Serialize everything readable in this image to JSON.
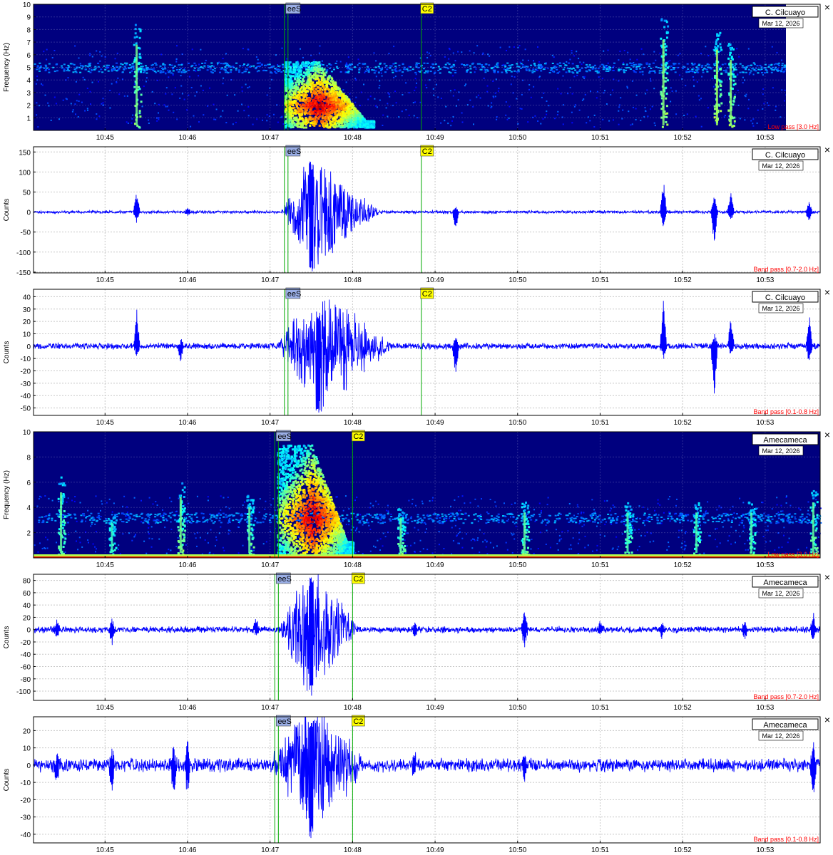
{
  "figure": {
    "time_ticks": [
      "10:45",
      "10:46",
      "10:47",
      "10:48",
      "10:49",
      "10:50",
      "10:51",
      "10:52",
      "10:53"
    ],
    "close_glyph": "×",
    "colors": {
      "trace": "#0000ff",
      "spectrogram_bg": "#00007f",
      "filter_label": "#ff0000",
      "pick_line": "#00aa00",
      "phase_marker_ees": "#9aaee6",
      "phase_marker_c2": "#ffff00",
      "grid": "#c8c8c8"
    }
  },
  "chart_data": [
    {
      "id": "p1",
      "type": "heatmap",
      "kind": "spectrogram",
      "station": "C. Cilcuayo",
      "date": "Mar 12, 2026",
      "filter": "Low pass [3.0 Hz]",
      "ylabel": "Frequency (Hz)",
      "ylim": [
        0,
        10
      ],
      "yticks": [
        "1",
        "2",
        "3",
        "4",
        "5",
        "6",
        "7",
        "8",
        "9",
        "10"
      ],
      "ytick_values": [
        1,
        2,
        3,
        4,
        5,
        6,
        7,
        8,
        9,
        10
      ],
      "xlim": [
        "10:44:08",
        "10:53:40"
      ],
      "picks": [
        {
          "label": "eeS",
          "time": "10:47:12"
        },
        {
          "label": "C2",
          "time": "10:48:50"
        }
      ],
      "events": [
        {
          "time": "10:45:23",
          "fmax": 8.5,
          "strength": 0.7
        },
        {
          "time": "10:51:46",
          "fmax": 9.0,
          "strength": 0.8
        },
        {
          "time": "10:52:25",
          "fmax": 8.0,
          "strength": 0.9
        },
        {
          "time": "10:52:35",
          "fmax": 7.0,
          "strength": 0.8
        }
      ],
      "noise_band_hz": 5.0,
      "main_event": {
        "start": "10:47:10",
        "end": "10:48:15",
        "peak_time": "10:47:35",
        "fmax": 5.5,
        "peak_freq": 2.0
      }
    },
    {
      "id": "p2",
      "type": "line",
      "kind": "waveform",
      "station": "C. Cilcuayo",
      "date": "Mar 12, 2026",
      "filter": "Band pass [0.7-2.0 Hz]",
      "ylabel": "Counts",
      "ylim": [
        -152,
        163
      ],
      "yticks": [
        "150",
        "100",
        "50",
        "0",
        "-50",
        "-100",
        "-150"
      ],
      "ytick_values": [
        150,
        100,
        50,
        0,
        -50,
        -100,
        -150
      ],
      "xlim": [
        "10:44:08",
        "10:53:40"
      ],
      "picks": [
        {
          "label": "eeS",
          "time": "10:47:12"
        },
        {
          "label": "C2",
          "time": "10:48:50"
        }
      ],
      "noise_level": 3,
      "main_event": {
        "start": "10:47:08",
        "peak_time": "10:47:30",
        "end": "10:48:20",
        "max": 130,
        "min": -150
      },
      "spikes": [
        {
          "time": "10:45:23",
          "max": 55,
          "min": -30
        },
        {
          "time": "10:46:00",
          "max": 10,
          "min": -10
        },
        {
          "time": "10:49:15",
          "max": 15,
          "min": -55
        },
        {
          "time": "10:51:46",
          "max": 85,
          "min": -45
        },
        {
          "time": "10:52:23",
          "max": 45,
          "min": -90
        },
        {
          "time": "10:52:35",
          "max": 55,
          "min": -25
        },
        {
          "time": "10:53:32",
          "max": 25,
          "min": -25
        }
      ]
    },
    {
      "id": "p3",
      "type": "line",
      "kind": "waveform",
      "station": "C. Cilcuayo",
      "date": "Mar 12, 2026",
      "filter": "Band pass [0.1-0.8 Hz]",
      "ylabel": "Counts",
      "ylim": [
        -56,
        46
      ],
      "yticks": [
        "40",
        "30",
        "20",
        "10",
        "0",
        "-10",
        "-20",
        "-30",
        "-40",
        "-50"
      ],
      "ytick_values": [
        40,
        30,
        20,
        10,
        0,
        -10,
        -20,
        -30,
        -40,
        -50
      ],
      "xlim": [
        "10:44:08",
        "10:53:40"
      ],
      "picks": [
        {
          "label": "eeS",
          "time": "10:47:12"
        },
        {
          "label": "C2",
          "time": "10:48:50"
        }
      ],
      "noise_level": 2,
      "main_event": {
        "start": "10:47:05",
        "peak_time": "10:47:35",
        "end": "10:48:30",
        "max": 28,
        "min": -55
      },
      "spikes": [
        {
          "time": "10:45:23",
          "max": 32,
          "min": -10
        },
        {
          "time": "10:45:55",
          "max": 5,
          "min": -13
        },
        {
          "time": "10:49:15",
          "max": 8,
          "min": -27
        },
        {
          "time": "10:51:46",
          "max": 40,
          "min": -12
        },
        {
          "time": "10:52:23",
          "max": 12,
          "min": -47
        },
        {
          "time": "10:52:35",
          "max": 25,
          "min": -8
        },
        {
          "time": "10:53:32",
          "max": 28,
          "min": -14
        }
      ]
    },
    {
      "id": "p4",
      "type": "heatmap",
      "kind": "spectrogram",
      "station": "Amecameca",
      "date": "Mar 12, 2026",
      "filter": "Low pass [3.0 Hz]",
      "ylabel": "Frequency (Hz)",
      "ylim": [
        0,
        10
      ],
      "yticks": [
        "2",
        "4",
        "6",
        "8",
        "10"
      ],
      "ytick_values": [
        2,
        4,
        6,
        8,
        10
      ],
      "xlim": [
        "10:44:08",
        "10:53:40"
      ],
      "picks": [
        {
          "label": "eeS",
          "time": "10:47:05"
        },
        {
          "label": "C2",
          "time": "10:48:00"
        }
      ],
      "events": [
        {
          "time": "10:44:28",
          "fmax": 6.5,
          "strength": 0.6
        },
        {
          "time": "10:45:05",
          "fmax": 3.5,
          "strength": 0.4
        },
        {
          "time": "10:45:55",
          "fmax": 6.0,
          "strength": 0.7
        },
        {
          "time": "10:46:45",
          "fmax": 5.0,
          "strength": 0.6
        },
        {
          "time": "10:48:35",
          "fmax": 4.0,
          "strength": 0.6
        },
        {
          "time": "10:50:05",
          "fmax": 4.5,
          "strength": 0.6
        },
        {
          "time": "10:51:20",
          "fmax": 4.5,
          "strength": 0.5
        },
        {
          "time": "10:52:10",
          "fmax": 4.5,
          "strength": 0.5
        },
        {
          "time": "10:52:50",
          "fmax": 4.5,
          "strength": 0.5
        },
        {
          "time": "10:53:35",
          "fmax": 5.5,
          "strength": 0.6
        }
      ],
      "noise_band_hz": 3.2,
      "low_band": true,
      "main_event": {
        "start": "10:47:05",
        "end": "10:48:00",
        "peak_time": "10:47:30",
        "fmax": 9.0,
        "peak_freq": 3.2
      }
    },
    {
      "id": "p5",
      "type": "line",
      "kind": "waveform",
      "station": "Amecameca",
      "date": "Mar 12, 2026",
      "filter": "Band pass [0.7-2.0 Hz]",
      "ylabel": "Counts",
      "ylim": [
        -115,
        90
      ],
      "yticks": [
        "80",
        "60",
        "40",
        "20",
        "0",
        "-20",
        "-40",
        "-60",
        "-80",
        "-100"
      ],
      "ytick_values": [
        80,
        60,
        40,
        20,
        0,
        -20,
        -40,
        -60,
        -80,
        -100
      ],
      "xlim": [
        "10:44:08",
        "10:53:40"
      ],
      "picks": [
        {
          "label": "eeS",
          "time": "10:47:05"
        },
        {
          "label": "C2",
          "time": "10:48:00"
        }
      ],
      "noise_level": 4,
      "main_event": {
        "start": "10:47:05",
        "peak_time": "10:47:30",
        "end": "10:48:05",
        "max": 85,
        "min": -112
      },
      "spikes": [
        {
          "time": "10:44:25",
          "max": 15,
          "min": -15
        },
        {
          "time": "10:45:05",
          "max": 18,
          "min": -28
        },
        {
          "time": "10:46:50",
          "max": 20,
          "min": -10
        },
        {
          "time": "10:48:45",
          "max": 15,
          "min": -15
        },
        {
          "time": "10:50:05",
          "max": 35,
          "min": -35
        },
        {
          "time": "10:51:00",
          "max": 15,
          "min": -12
        },
        {
          "time": "10:51:45",
          "max": 14,
          "min": -14
        },
        {
          "time": "10:52:45",
          "max": 16,
          "min": -16
        },
        {
          "time": "10:53:35",
          "max": 28,
          "min": -22
        }
      ]
    },
    {
      "id": "p6",
      "type": "line",
      "kind": "waveform",
      "station": "Amecameca",
      "date": "Mar 12, 2026",
      "filter": "Band pass [0.1-0.8 Hz]",
      "ylabel": "Counts",
      "ylim": [
        -45,
        28
      ],
      "yticks": [
        "20",
        "10",
        "0",
        "-10",
        "-20",
        "-30",
        "-40"
      ],
      "ytick_values": [
        20,
        10,
        0,
        -10,
        -20,
        -30,
        -40
      ],
      "xlim": [
        "10:44:08",
        "10:53:40"
      ],
      "picks": [
        {
          "label": "eeS",
          "time": "10:47:05"
        },
        {
          "label": "C2",
          "time": "10:48:00"
        }
      ],
      "noise_level": 3,
      "main_event": {
        "start": "10:47:00",
        "peak_time": "10:47:30",
        "end": "10:48:10",
        "max": 27,
        "min": -44
      },
      "spikes": [
        {
          "time": "10:44:25",
          "max": 8,
          "min": -12
        },
        {
          "time": "10:45:05",
          "max": 10,
          "min": -18
        },
        {
          "time": "10:45:50",
          "max": 12,
          "min": -22
        },
        {
          "time": "10:46:00",
          "max": 13,
          "min": -20
        },
        {
          "time": "10:48:45",
          "max": 8,
          "min": -8
        },
        {
          "time": "10:50:05",
          "max": 8,
          "min": -9
        },
        {
          "time": "10:53:35",
          "max": 15,
          "min": -17
        }
      ]
    }
  ]
}
